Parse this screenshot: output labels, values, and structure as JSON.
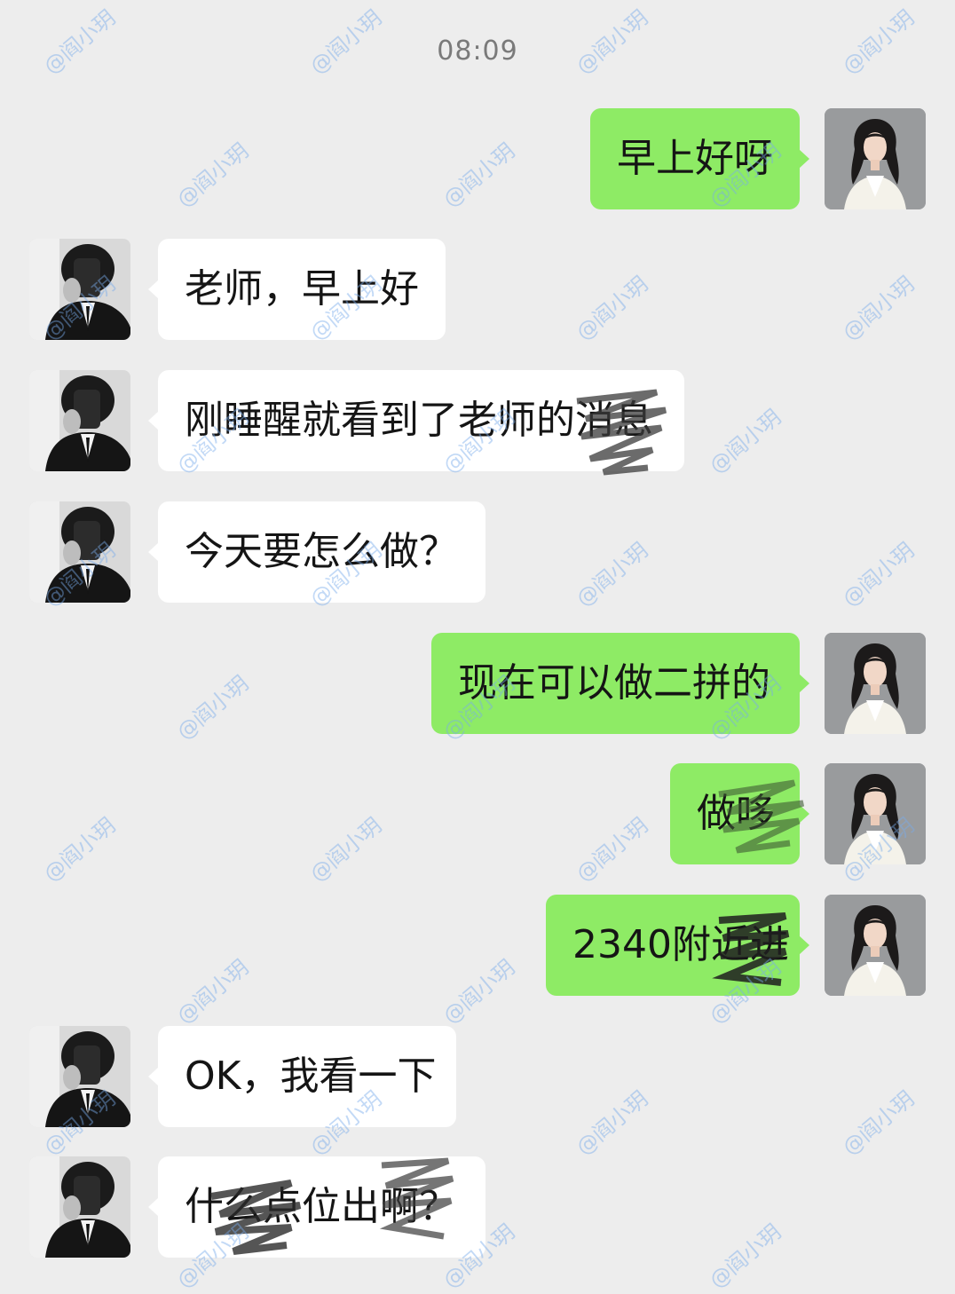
{
  "timestamp": "08:09",
  "messages": [
    {
      "side": "right",
      "sender": "teacher",
      "text": "早上好呀"
    },
    {
      "side": "left",
      "sender": "student",
      "text": "老师，早上好"
    },
    {
      "side": "left",
      "sender": "student",
      "text": "刚睡醒就看到了老师的消息"
    },
    {
      "side": "left",
      "sender": "student",
      "text": "今天要怎么做？"
    },
    {
      "side": "right",
      "sender": "teacher",
      "text": "现在可以做二拼的"
    },
    {
      "side": "right",
      "sender": "teacher",
      "text": "做哆"
    },
    {
      "side": "right",
      "sender": "teacher",
      "text": "2340附近进"
    },
    {
      "side": "left",
      "sender": "student",
      "text": "OK，我看一下"
    },
    {
      "side": "left",
      "sender": "student",
      "text": "什么点位出啊？"
    }
  ],
  "watermark": "@阎小玥",
  "colors": {
    "background": "#ededed",
    "incoming_bubble": "#ffffff",
    "outgoing_bubble": "#8eeb65",
    "timestamp_text": "#7a7a7a"
  },
  "icons": {
    "student_avatar": "person-avatar-icon",
    "teacher_avatar": "woman-avatar-icon"
  }
}
